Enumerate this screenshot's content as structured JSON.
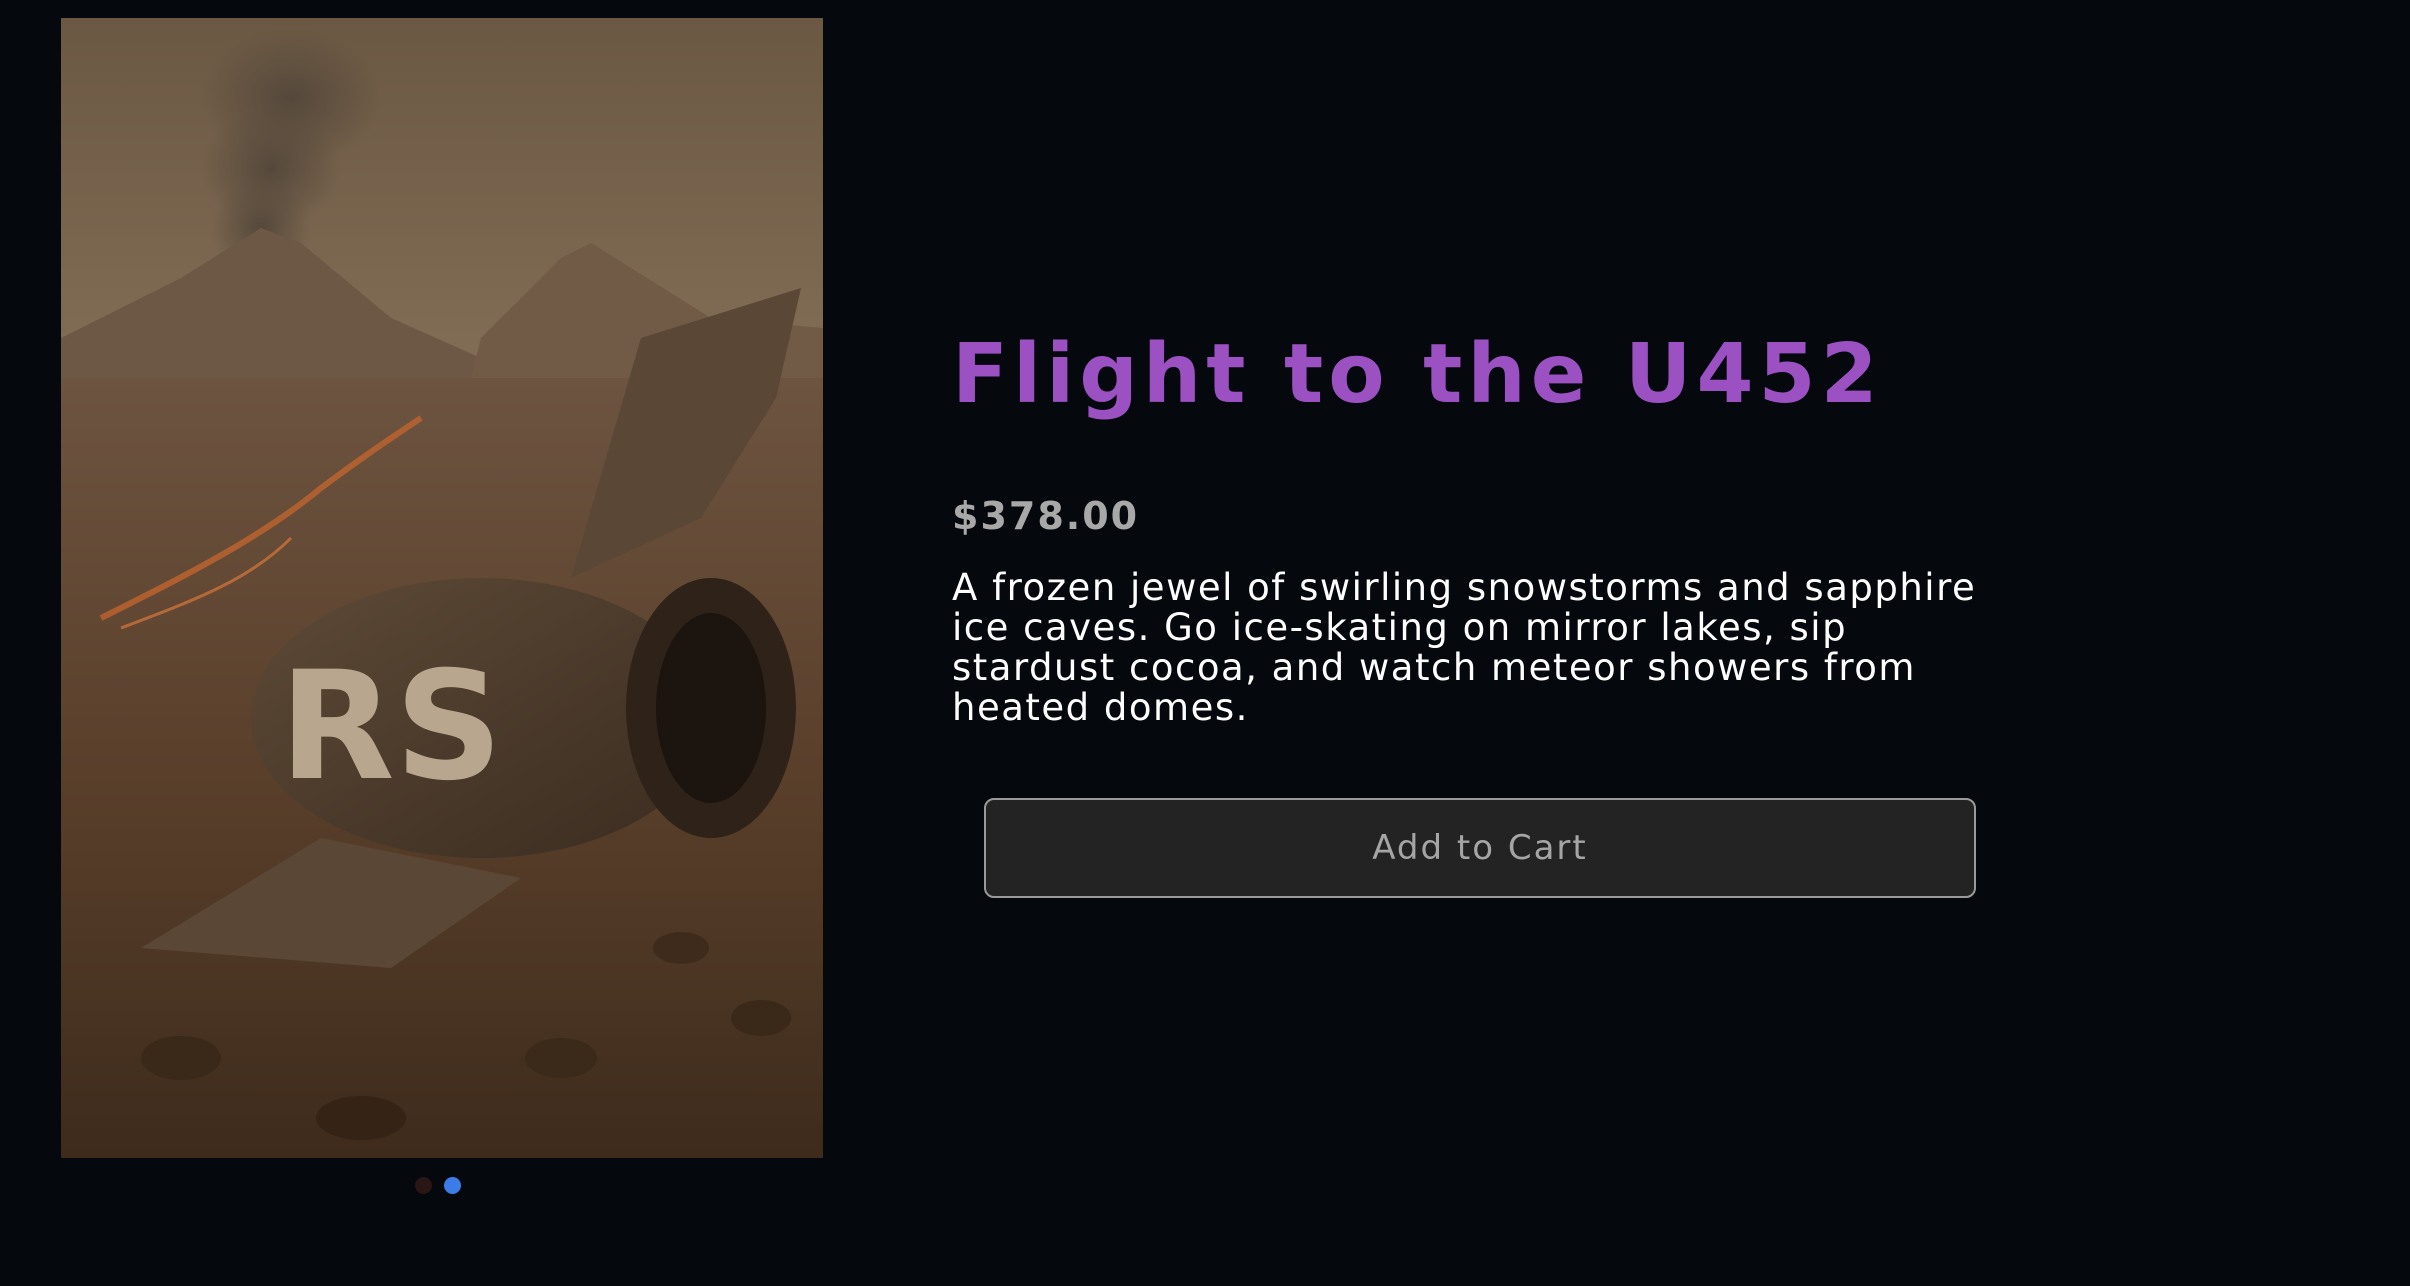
{
  "product": {
    "title": "Flight to the U452",
    "price": "$378.00",
    "description": "A frozen jewel of swirling snowstorms and sapphire ice caves. Go ice-skating on mirror lakes, sip stardust cocoa, and watch meteor showers from heated domes.",
    "add_to_cart_label": "Add to Cart"
  },
  "gallery": {
    "image_logo_text": "RS",
    "image_subject": "crashed-spaceship-on-volcanic-desert",
    "slides": [
      {
        "active": false,
        "color": "#2a1616"
      },
      {
        "active": true,
        "color": "#3b7ce8"
      }
    ]
  },
  "colors": {
    "background": "#05080d",
    "title": "#9b51c2",
    "price": "#a8a8a8",
    "description": "#ffffff",
    "button_bg": "#232323",
    "button_border": "#9a9a9a",
    "button_text": "#a5a5a5",
    "dot_active": "#3b7ce8"
  }
}
